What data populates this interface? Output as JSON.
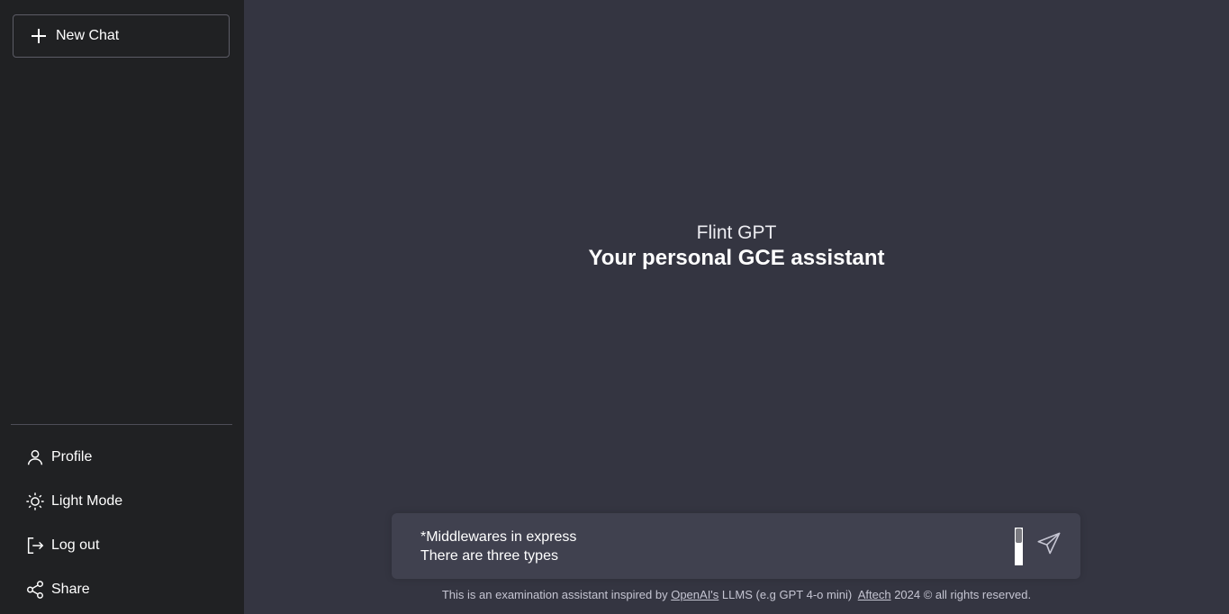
{
  "sidebar": {
    "new_chat_label": "New Chat",
    "items": [
      {
        "label": "Profile",
        "icon": "user-icon"
      },
      {
        "label": "Light Mode",
        "icon": "sun-icon"
      },
      {
        "label": "Log out",
        "icon": "logout-icon"
      },
      {
        "label": "Share",
        "icon": "share-icon"
      }
    ]
  },
  "hero": {
    "title": "Flint GPT",
    "subtitle": "Your personal GCE assistant"
  },
  "composer": {
    "value": "*Middlewares in express\nThere are three types",
    "send_icon": "send-icon"
  },
  "footer": {
    "prefix": "This is an examination assistant inspired by",
    "openai_link": "OpenAI's",
    "middle": "LLMS (e.g GPT 4-o mini)",
    "aftech_link": "Aftech",
    "suffix": "2024 © all rights reserved."
  },
  "colors": {
    "sidebar_bg": "#202123",
    "main_bg": "#343541",
    "composer_bg": "#40414f"
  }
}
